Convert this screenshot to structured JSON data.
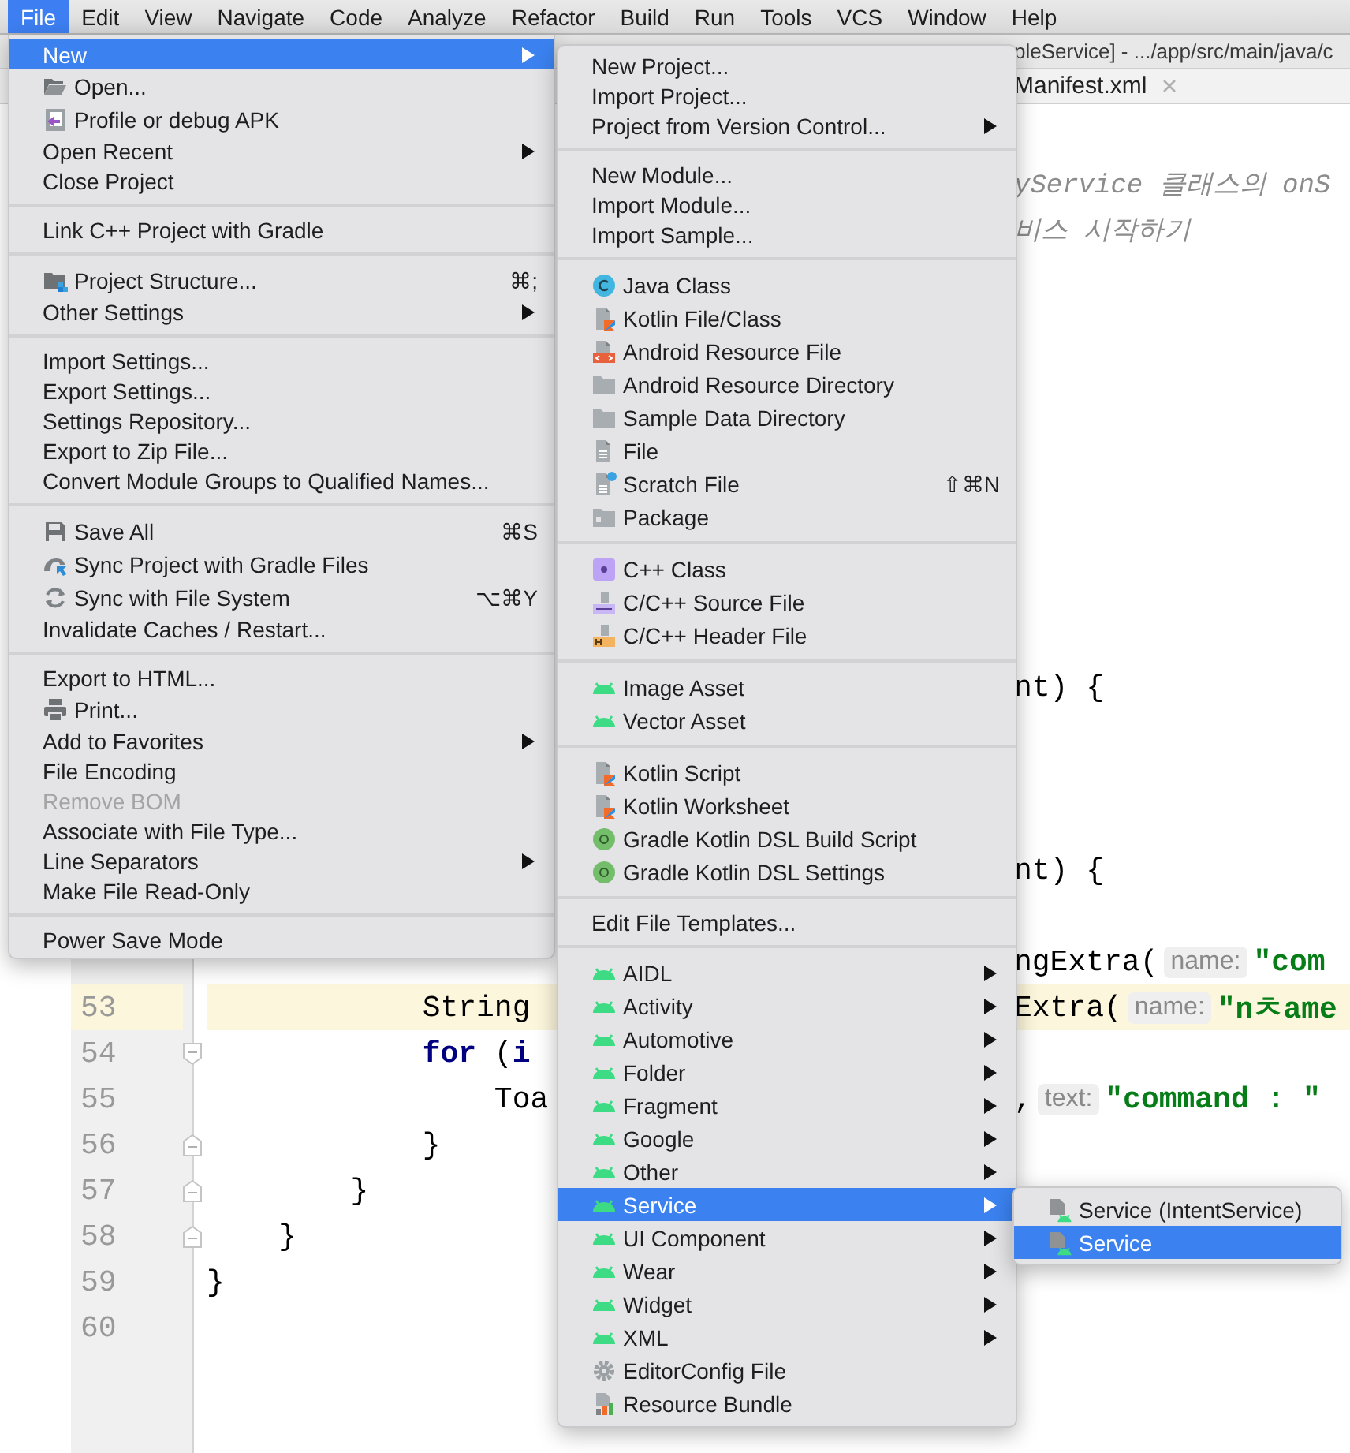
{
  "menu_bar": {
    "items": [
      {
        "label": "File",
        "selected": true
      },
      {
        "label": "Edit",
        "selected": false
      },
      {
        "label": "View",
        "selected": false
      },
      {
        "label": "Navigate",
        "selected": false
      },
      {
        "label": "Code",
        "selected": false
      },
      {
        "label": "Analyze",
        "selected": false
      },
      {
        "label": "Refactor",
        "selected": false
      },
      {
        "label": "Build",
        "selected": false
      },
      {
        "label": "Run",
        "selected": false
      },
      {
        "label": "Tools",
        "selected": false
      },
      {
        "label": "VCS",
        "selected": false
      },
      {
        "label": "Window",
        "selected": false
      },
      {
        "label": "Help",
        "selected": false
      }
    ]
  },
  "title_bar": {
    "title": "pleService] - .../app/src/main/java/c"
  },
  "editor_tab": {
    "label": "Manifest.xml"
  },
  "editor": {
    "lines": [
      {
        "current": false,
        "right": [
          {
            "text": "yService 클래스의 onS",
            "kind": "comment"
          }
        ]
      },
      {
        "current": false,
        "right": [
          {
            "text": "비스 시작하기",
            "kind": "comment"
          }
        ]
      },
      {
        "current": false
      },
      {
        "current": false
      },
      {
        "current": false
      },
      {
        "current": false
      },
      {
        "current": false
      },
      {
        "current": false
      },
      {
        "current": false
      },
      {
        "current": false
      },
      {
        "current": false
      },
      {
        "current": false,
        "right": [
          {
            "text": "nt) {",
            "kind": "plain"
          }
        ]
      },
      {
        "current": false
      },
      {
        "current": false
      },
      {
        "current": false
      },
      {
        "current": false,
        "right": [
          {
            "text": "nt) {",
            "kind": "plain"
          }
        ]
      },
      {
        "current": false
      },
      {
        "current": false,
        "right": [
          {
            "text": "ngExtra(",
            "kind": "plain"
          },
          {
            "text": "name:",
            "kind": "hint"
          },
          {
            "text": "\"com",
            "kind": "string"
          }
        ]
      },
      {
        "number": "53",
        "current": true,
        "left": [
          {
            "text": "            String",
            "kind": "plain"
          }
        ],
        "right": [
          {
            "text": "Extra(",
            "kind": "plain"
          },
          {
            "text": "name:",
            "kind": "hint"
          },
          {
            "text": "\"nㅊame",
            "kind": "string"
          }
        ]
      },
      {
        "number": "54",
        "current": false,
        "fold": {
          "kind": "start"
        },
        "left": [
          {
            "text": "            for",
            "kind": "keyword"
          },
          {
            "text": " (",
            "kind": "plain"
          },
          {
            "text": "i",
            "kind": "keyword"
          }
        ]
      },
      {
        "number": "55",
        "current": false,
        "left": [
          {
            "text": "                Toa",
            "kind": "plain"
          }
        ],
        "right": [
          {
            "text": ",",
            "kind": "plain"
          },
          {
            "text": "text:",
            "kind": "hint"
          },
          {
            "text": "\"command : \"",
            "kind": "string"
          }
        ]
      },
      {
        "number": "56",
        "current": false,
        "fold": {
          "kind": "end"
        },
        "left": [
          {
            "text": "            }",
            "kind": "plain"
          }
        ]
      },
      {
        "number": "57",
        "current": false,
        "fold": {
          "kind": "end"
        },
        "left": [
          {
            "text": "        }",
            "kind": "plain"
          }
        ]
      },
      {
        "number": "58",
        "current": false,
        "fold": {
          "kind": "end"
        },
        "left": [
          {
            "text": "    }",
            "kind": "plain"
          }
        ]
      },
      {
        "number": "59",
        "current": false,
        "left": [
          {
            "text": "}",
            "kind": "plain"
          }
        ]
      },
      {
        "number": "60",
        "current": false
      }
    ]
  },
  "file_menu": {
    "groups": [
      [
        {
          "label": "New",
          "kind": "plain",
          "selected": true,
          "disabled": false,
          "submenu": true
        },
        {
          "label": "Open...",
          "kind": "opendir",
          "selected": false,
          "disabled": false,
          "submenu": false
        },
        {
          "label": "Profile or debug APK",
          "kind": "apk",
          "selected": false,
          "disabled": false,
          "submenu": false
        },
        {
          "label": "Open Recent",
          "kind": "plain",
          "selected": false,
          "disabled": false,
          "submenu": true
        },
        {
          "label": "Close Project",
          "kind": "plain",
          "selected": false,
          "disabled": false,
          "submenu": false
        }
      ],
      [
        {
          "label": "Link C++ Project with Gradle",
          "kind": "plain",
          "selected": false,
          "disabled": false,
          "submenu": false
        }
      ],
      [
        {
          "label": "Project Structure...",
          "kind": "structure",
          "selected": false,
          "disabled": false,
          "submenu": false,
          "shortcut": "⌘;"
        },
        {
          "label": "Other Settings",
          "kind": "plain",
          "selected": false,
          "disabled": false,
          "submenu": true
        }
      ],
      [
        {
          "label": "Import Settings...",
          "kind": "plain",
          "selected": false,
          "disabled": false,
          "submenu": false
        },
        {
          "label": "Export Settings...",
          "kind": "plain",
          "selected": false,
          "disabled": false,
          "submenu": false
        },
        {
          "label": "Settings Repository...",
          "kind": "plain",
          "selected": false,
          "disabled": false,
          "submenu": false
        },
        {
          "label": "Export to Zip File...",
          "kind": "plain",
          "selected": false,
          "disabled": false,
          "submenu": false
        },
        {
          "label": "Convert Module Groups to Qualified Names...",
          "kind": "plain",
          "selected": false,
          "disabled": false,
          "submenu": false
        }
      ],
      [
        {
          "label": "Save All",
          "kind": "save",
          "selected": false,
          "disabled": false,
          "submenu": false,
          "shortcut": "⌘S"
        },
        {
          "label": "Sync Project with Gradle Files",
          "kind": "gradlesync",
          "selected": false,
          "disabled": false,
          "submenu": false
        },
        {
          "label": "Sync with File System",
          "kind": "sync",
          "selected": false,
          "disabled": false,
          "submenu": false,
          "shortcut": "⌥⌘Y"
        },
        {
          "label": "Invalidate Caches / Restart...",
          "kind": "plain",
          "selected": false,
          "disabled": false,
          "submenu": false
        }
      ],
      [
        {
          "label": "Export to HTML...",
          "kind": "plain",
          "selected": false,
          "disabled": false,
          "submenu": false
        },
        {
          "label": "Print...",
          "kind": "printer",
          "selected": false,
          "disabled": false,
          "submenu": false
        },
        {
          "label": "Add to Favorites",
          "kind": "plain",
          "selected": false,
          "disabled": false,
          "submenu": true
        },
        {
          "label": "File Encoding",
          "kind": "plain",
          "selected": false,
          "disabled": false,
          "submenu": false
        },
        {
          "label": "Remove BOM",
          "kind": "plain",
          "selected": false,
          "disabled": true,
          "submenu": false
        },
        {
          "label": "Associate with File Type...",
          "kind": "plain",
          "selected": false,
          "disabled": false,
          "submenu": false
        },
        {
          "label": "Line Separators",
          "kind": "plain",
          "selected": false,
          "disabled": false,
          "submenu": true
        },
        {
          "label": "Make File Read-Only",
          "kind": "plain",
          "selected": false,
          "disabled": false,
          "submenu": false
        }
      ],
      [
        {
          "label": "Power Save Mode",
          "kind": "plain",
          "selected": false,
          "disabled": false,
          "submenu": false
        }
      ]
    ]
  },
  "new_submenu": {
    "groups": [
      [
        {
          "label": "New Project...",
          "kind": "plain",
          "selected": false,
          "submenu": false
        },
        {
          "label": "Import Project...",
          "kind": "plain",
          "selected": false,
          "submenu": false
        },
        {
          "label": "Project from Version Control...",
          "kind": "plain",
          "selected": false,
          "submenu": true
        }
      ],
      [
        {
          "label": "New Module...",
          "kind": "plain",
          "selected": false,
          "submenu": false
        },
        {
          "label": "Import Module...",
          "kind": "plain",
          "selected": false,
          "submenu": false
        },
        {
          "label": "Import Sample...",
          "kind": "plain",
          "selected": false,
          "submenu": false
        }
      ],
      [
        {
          "label": "Java Class",
          "kind": "javaclass",
          "selected": false,
          "submenu": false
        },
        {
          "label": "Kotlin File/Class",
          "kind": "kotlin",
          "selected": false,
          "submenu": false
        },
        {
          "label": "Android Resource File",
          "kind": "resfile",
          "selected": false,
          "submenu": false
        },
        {
          "label": "Android Resource Directory",
          "kind": "folder",
          "selected": false,
          "submenu": false
        },
        {
          "label": "Sample Data Directory",
          "kind": "folder",
          "selected": false,
          "submenu": false
        },
        {
          "label": "File",
          "kind": "file",
          "selected": false,
          "submenu": false
        },
        {
          "label": "Scratch File",
          "kind": "scratch",
          "selected": false,
          "submenu": false,
          "shortcut": "⇧⌘N"
        },
        {
          "label": "Package",
          "kind": "package",
          "selected": false,
          "submenu": false
        }
      ],
      [
        {
          "label": "C++ Class",
          "kind": "cppclass",
          "selected": false,
          "submenu": false
        },
        {
          "label": "C/C++ Source File",
          "kind": "cppsource",
          "selected": false,
          "submenu": false
        },
        {
          "label": "C/C++ Header File",
          "kind": "cppheader",
          "selected": false,
          "submenu": false
        }
      ],
      [
        {
          "label": "Image Asset",
          "kind": "android",
          "selected": false,
          "submenu": false
        },
        {
          "label": "Vector Asset",
          "kind": "android",
          "selected": false,
          "submenu": false
        }
      ],
      [
        {
          "label": "Kotlin Script",
          "kind": "kotlin",
          "selected": false,
          "submenu": false
        },
        {
          "label": "Kotlin Worksheet",
          "kind": "kotlin",
          "selected": false,
          "submenu": false
        },
        {
          "label": "Gradle Kotlin DSL Build Script",
          "kind": "gradle",
          "selected": false,
          "submenu": false
        },
        {
          "label": "Gradle Kotlin DSL Settings",
          "kind": "gradle",
          "selected": false,
          "submenu": false
        }
      ],
      [
        {
          "label": "Edit File Templates...",
          "kind": "plain",
          "selected": false,
          "submenu": false
        }
      ],
      [
        {
          "label": "AIDL",
          "kind": "android",
          "selected": false,
          "submenu": true
        },
        {
          "label": "Activity",
          "kind": "android",
          "selected": false,
          "submenu": true
        },
        {
          "label": "Automotive",
          "kind": "android",
          "selected": false,
          "submenu": true
        },
        {
          "label": "Folder",
          "kind": "android",
          "selected": false,
          "submenu": true
        },
        {
          "label": "Fragment",
          "kind": "android",
          "selected": false,
          "submenu": true
        },
        {
          "label": "Google",
          "kind": "android",
          "selected": false,
          "submenu": true
        },
        {
          "label": "Other",
          "kind": "android",
          "selected": false,
          "submenu": true
        },
        {
          "label": "Service",
          "kind": "android",
          "selected": true,
          "submenu": true
        },
        {
          "label": "UI Component",
          "kind": "android",
          "selected": false,
          "submenu": true
        },
        {
          "label": "Wear",
          "kind": "android",
          "selected": false,
          "submenu": true
        },
        {
          "label": "Widget",
          "kind": "android",
          "selected": false,
          "submenu": true
        },
        {
          "label": "XML",
          "kind": "android",
          "selected": false,
          "submenu": true
        },
        {
          "label": "EditorConfig File",
          "kind": "gear",
          "selected": false,
          "submenu": false
        },
        {
          "label": "Resource Bundle",
          "kind": "bundle",
          "selected": false,
          "submenu": false
        }
      ]
    ]
  },
  "service_submenu": {
    "groups": [
      [
        {
          "label": "Service (IntentService)",
          "kind": "servicefile",
          "selected": false,
          "submenu": false
        },
        {
          "label": "Service",
          "kind": "servicefile",
          "selected": true,
          "submenu": false
        }
      ]
    ]
  }
}
